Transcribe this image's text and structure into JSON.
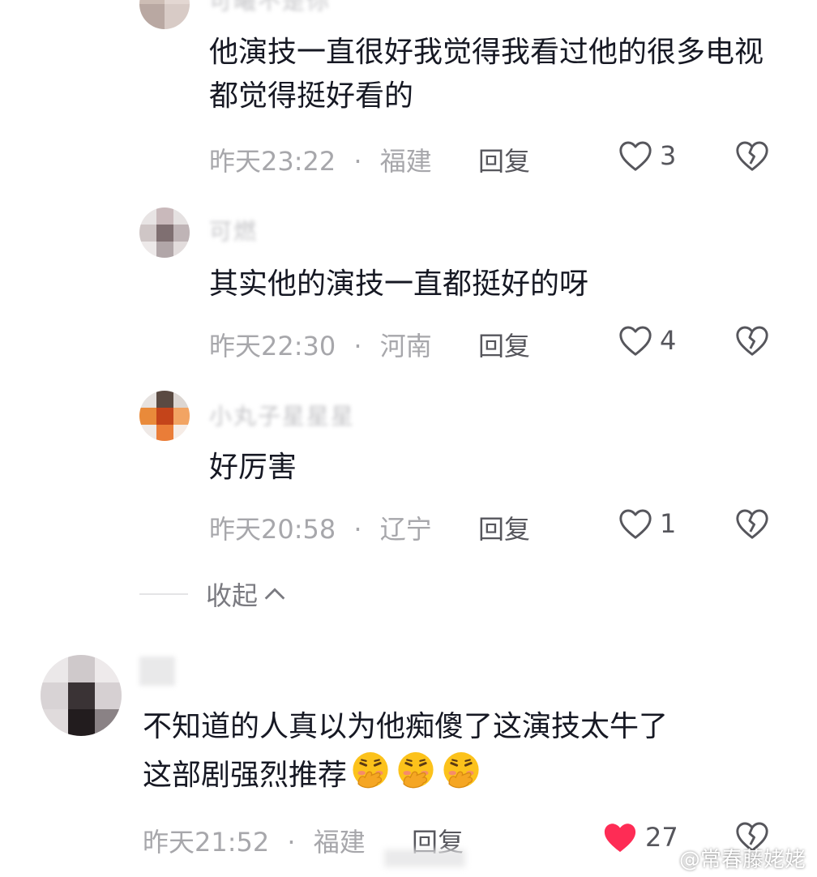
{
  "comments": [
    {
      "name": "可曦不是你",
      "text": "他演技一直很好我觉得我看过他的很多电视都觉得挺好看的",
      "time": "昨天23:22",
      "location": "福建",
      "reply_label": "回复",
      "likes": "3"
    },
    {
      "name": "可燃",
      "text": "其实他的演技一直都挺好的呀",
      "time": "昨天22:30",
      "location": "河南",
      "reply_label": "回复",
      "likes": "4"
    },
    {
      "name": "小丸子星星星",
      "text": "好厉害",
      "time": "昨天20:58",
      "location": "辽宁",
      "reply_label": "回复",
      "likes": "1"
    }
  ],
  "collapse_label": "收起",
  "main_comment": {
    "text_line1": "不知道的人真以为他痴傻了这演技太牛了",
    "text_line2": "这部剧强烈推荐",
    "emoji_name": "hand-over-mouth-laugh-emoji",
    "time": "昨天21:52",
    "location": "福建",
    "reply_label": "回复",
    "likes": "27",
    "liked": true
  },
  "separator": "·",
  "watermark": {
    "handle": "@常春藤姥姥"
  },
  "colors": {
    "like_active": "#fe2c55",
    "meta": "#a7a7ab",
    "text": "#161823"
  }
}
